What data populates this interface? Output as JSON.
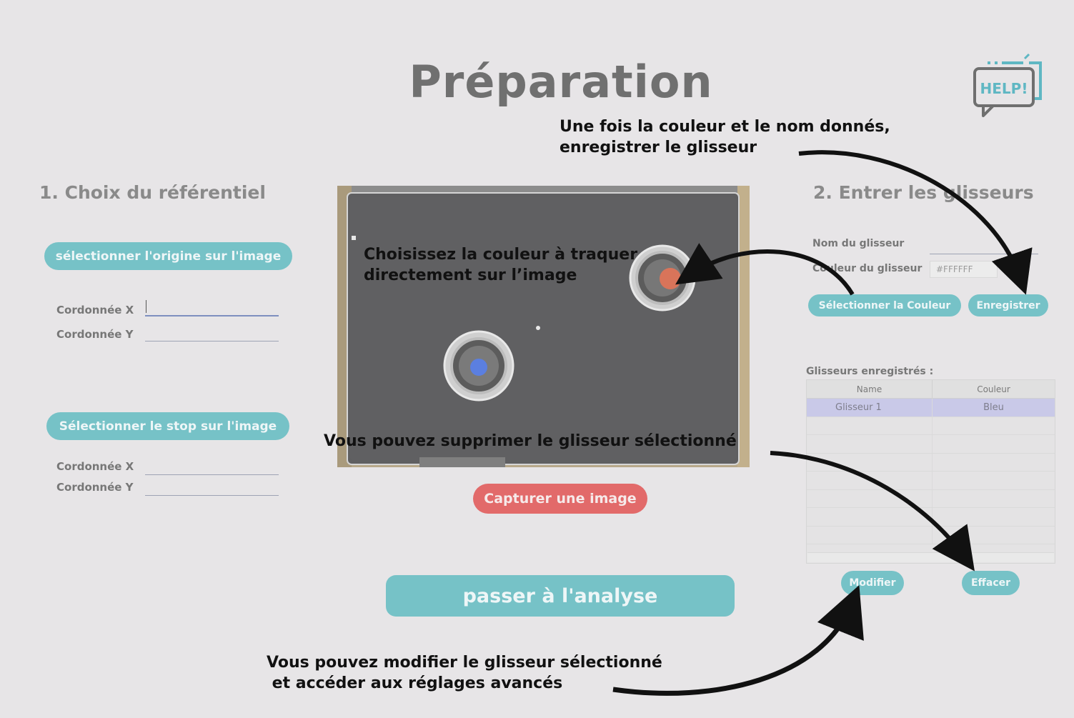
{
  "page": {
    "title": "Préparation"
  },
  "help": {
    "label": "HELP!"
  },
  "section1": {
    "title": "1. Choix du référentiel",
    "origin_button": "sélectionner l'origine sur l'image",
    "origin_x_label": "Cordonnée X",
    "origin_y_label": "Cordonnée Y",
    "stop_button": "Sélectionner le stop sur l'image",
    "stop_x_label": "Cordonnée X",
    "stop_y_label": "Cordonnée Y"
  },
  "center": {
    "capture_button": "Capturer une image",
    "analyse_button": "passer à l'analyse"
  },
  "section2": {
    "title": "2. Entrer les glisseurs",
    "name_label": "Nom du glisseur",
    "color_label": "Couleur du glisseur",
    "color_value": "#FFFFFF",
    "select_color_button": "Sélectionner la Couleur",
    "save_button": "Enregistrer",
    "list_title": "Glisseurs enregistrés :",
    "columns": [
      "Name",
      "Couleur"
    ],
    "rows": [
      {
        "name": "Glisseur 1",
        "color": "Bleu"
      }
    ],
    "modify_button": "Modifier",
    "delete_button": "Effacer"
  },
  "annotations": {
    "save_hint": "Une fois la couleur et le nom donnés,\nenregistrer le glisseur",
    "color_hint": "Choisissez la couleur à traquer\ndirectement sur l’image",
    "delete_hint": "Vous pouvez supprimer le glisseur sélectionné",
    "modify_hint": "Vous pouvez modifier le glisseur sélectionné\n et accéder aux réglages avancés"
  },
  "colors": {
    "accent": "#76c2c7",
    "capture": "#e26a6a",
    "background": "#e7e5e7",
    "selected_row": "#c9c9e8",
    "tracked_red": "#d9745a",
    "tracked_blue": "#5b7fe0"
  }
}
